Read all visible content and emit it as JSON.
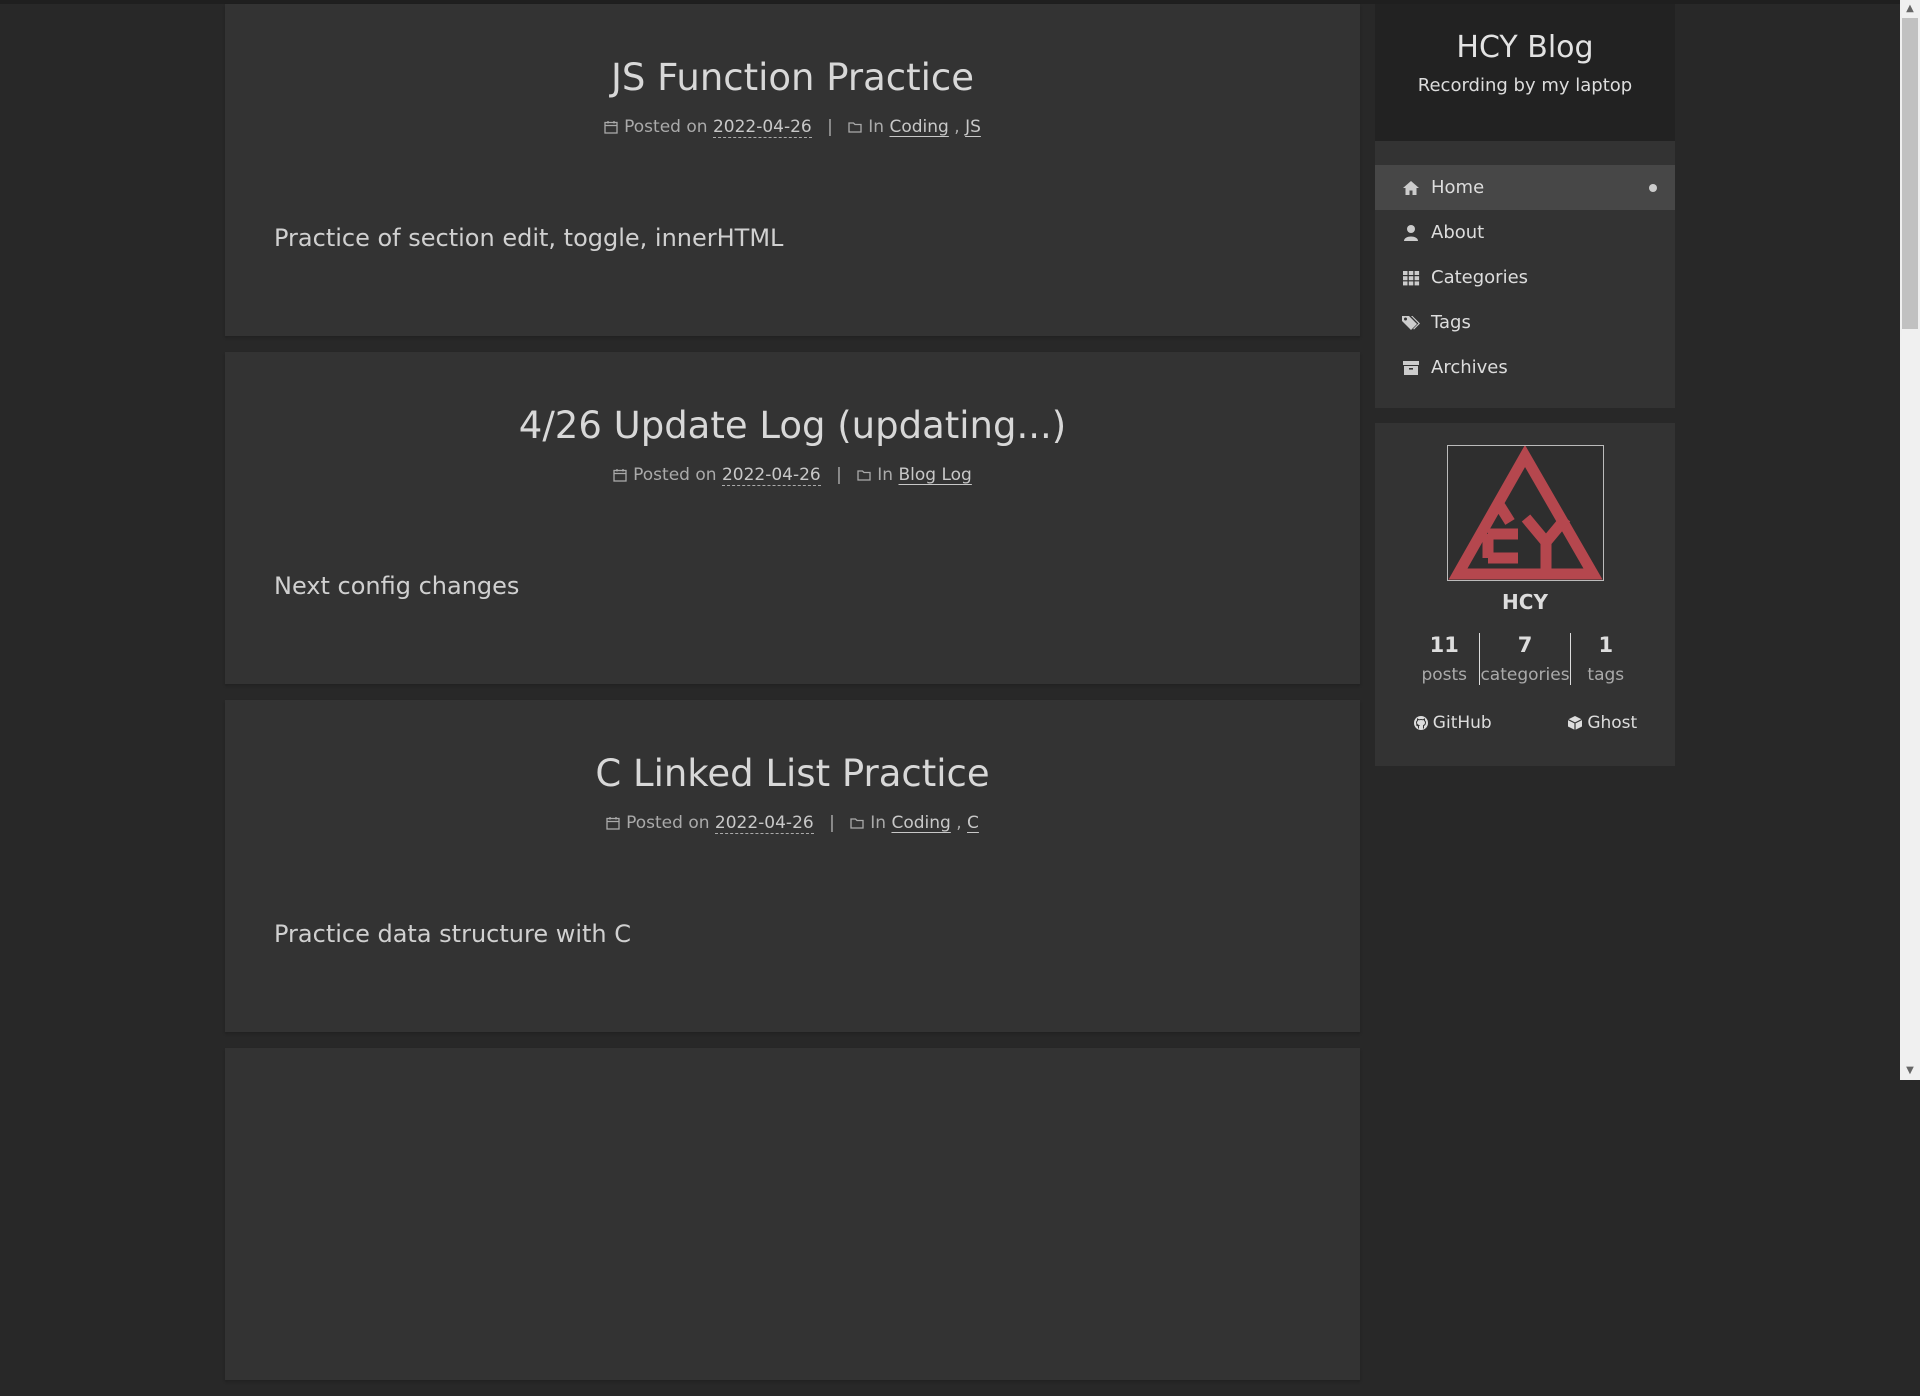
{
  "posts": [
    {
      "title": "JS Function Practice",
      "posted_on": "Posted on",
      "date": "2022-04-26",
      "sep": "|",
      "in": "In",
      "categories": [
        "Coding",
        "JS"
      ],
      "cat_sep": ",",
      "excerpt": "Practice of section edit, toggle, innerHTML"
    },
    {
      "title": "4/26 Update Log (updating...)",
      "posted_on": "Posted on",
      "date": "2022-04-26",
      "sep": "|",
      "in": "In",
      "categories": [
        "Blog Log"
      ],
      "excerpt": "Next config changes"
    },
    {
      "title": "C Linked List Practice",
      "posted_on": "Posted on",
      "date": "2022-04-26",
      "sep": "|",
      "in": "In",
      "categories": [
        "Coding",
        "C"
      ],
      "cat_sep": ",",
      "excerpt": "Practice data structure with C"
    }
  ],
  "sidebar": {
    "site_title": "HCY Blog",
    "site_subtitle": "Recording by my laptop",
    "menu": [
      {
        "label": "Home",
        "icon": "home-icon",
        "active": true
      },
      {
        "label": "About",
        "icon": "user-icon"
      },
      {
        "label": "Categories",
        "icon": "grid-icon"
      },
      {
        "label": "Tags",
        "icon": "tags-icon"
      },
      {
        "label": "Archives",
        "icon": "archive-icon"
      }
    ],
    "author": {
      "name": "HCY",
      "stats": [
        {
          "num": "11",
          "label": "posts"
        },
        {
          "num": "7",
          "label": "categories"
        },
        {
          "num": "1",
          "label": "tags"
        }
      ],
      "links": [
        {
          "label": "GitHub",
          "icon": "github-icon"
        },
        {
          "label": "Ghost",
          "icon": "ghost-icon"
        }
      ]
    }
  },
  "colors": {
    "background": "#282828",
    "card": "#333333",
    "brand_header": "#222222",
    "menu_active": "#474747",
    "avatar_logo": "#b5474e"
  }
}
